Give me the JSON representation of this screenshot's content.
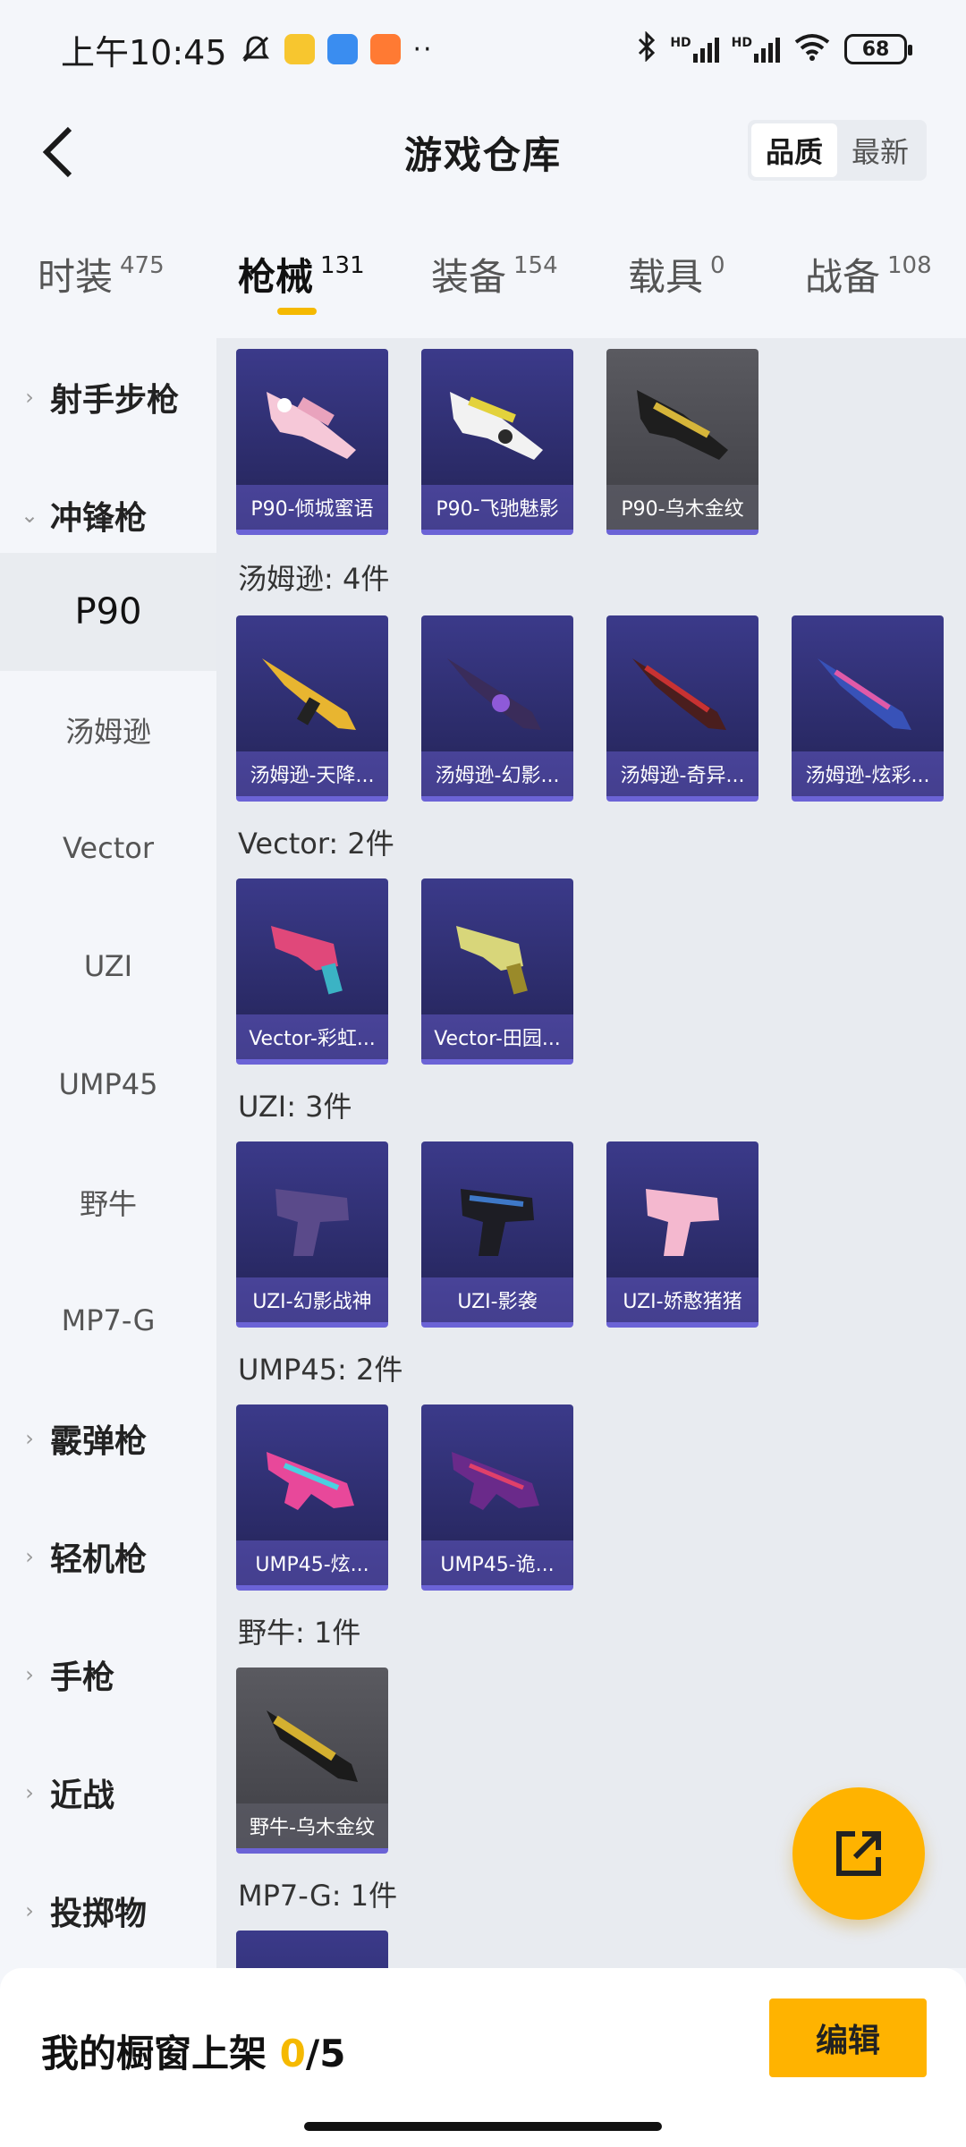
{
  "status_bar": {
    "time": "上午10:45",
    "battery": "68",
    "signal_label_1": "HD",
    "signal_label_2": "HD"
  },
  "header": {
    "title": "游戏仓库",
    "sort_options": [
      "品质",
      "最新"
    ],
    "sort_selected": "品质"
  },
  "tabs": [
    {
      "label": "时装",
      "count": "475"
    },
    {
      "label": "枪械",
      "count": "131"
    },
    {
      "label": "装备",
      "count": "154"
    },
    {
      "label": "载具",
      "count": "0"
    },
    {
      "label": "战备",
      "count": "108"
    }
  ],
  "active_tab": "枪械",
  "sidebar": {
    "groups": [
      {
        "label": "射手步枪",
        "expanded": false
      },
      {
        "label": "冲锋枪",
        "expanded": true
      },
      {
        "label": "霰弹枪",
        "expanded": false
      },
      {
        "label": "轻机枪",
        "expanded": false
      },
      {
        "label": "手枪",
        "expanded": false
      },
      {
        "label": "近战",
        "expanded": false
      },
      {
        "label": "投掷物",
        "expanded": false
      }
    ],
    "sub_items": [
      "P90",
      "汤姆逊",
      "Vector",
      "UZI",
      "UMP45",
      "野牛",
      "MP7-G"
    ],
    "active_sub": "P90"
  },
  "content": {
    "groups": [
      {
        "title": "",
        "items": [
          "P90-倾城蜜语",
          "P90-飞驰魅影",
          "P90-乌木金纹"
        ]
      },
      {
        "title": "汤姆逊: 4件",
        "items": [
          "汤姆逊-天降...",
          "汤姆逊-幻影...",
          "汤姆逊-奇异...",
          "汤姆逊-炫彩..."
        ]
      },
      {
        "title": "Vector: 2件",
        "items": [
          "Vector-彩虹...",
          "Vector-田园..."
        ]
      },
      {
        "title": "UZI: 3件",
        "items": [
          "UZI-幻影战神",
          "UZI-影袭",
          "UZI-娇憨猪猪"
        ]
      },
      {
        "title": "UMP45: 2件",
        "items": [
          "UMP45-炫...",
          "UMP45-诡..."
        ]
      },
      {
        "title": "野牛: 1件",
        "items": [
          "野牛-乌木金纹"
        ]
      },
      {
        "title": "MP7-G: 1件",
        "items": [
          ""
        ]
      }
    ]
  },
  "bottom": {
    "showcase_label": "我的橱窗上架",
    "showcase_current": "0",
    "showcase_total": "/5",
    "edit_label": "编辑"
  },
  "colors": {
    "accent": "#ffb300",
    "tab_underline": "#f5b900",
    "card_purple": "#2a2a66",
    "card_gold": "#47474d"
  }
}
